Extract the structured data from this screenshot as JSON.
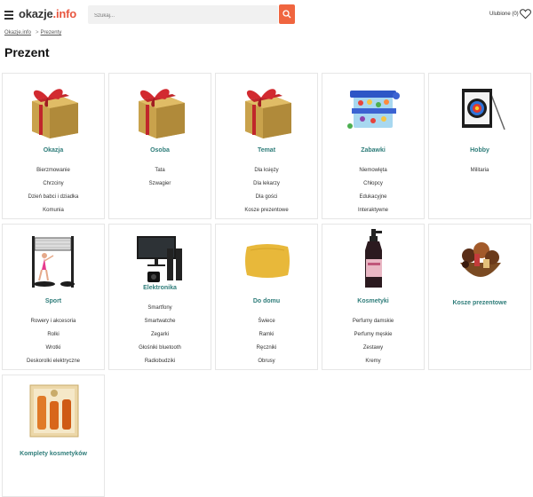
{
  "header": {
    "logo_main": "okazje",
    "logo_suffix": ".info",
    "search_placeholder": "Szukaj...",
    "favorites_label": "Ulubione (0)"
  },
  "breadcrumb": {
    "home": "Okazje.info",
    "separator": ">",
    "current": "Prezenty"
  },
  "page_title": "Prezent",
  "cards": [
    {
      "title": "Okazja",
      "icon": "gift-box",
      "items": [
        "Bierzmowanie",
        "Chrzciny",
        "Dzień babci i dziadka",
        "Komunia"
      ]
    },
    {
      "title": "Osoba",
      "icon": "gift-box",
      "items": [
        "Tata",
        "Szwagier"
      ]
    },
    {
      "title": "Temat",
      "icon": "gift-box",
      "items": [
        "Dla księży",
        "Dla lekarzy",
        "Dla gości",
        "Kosze prezentowe"
      ]
    },
    {
      "title": "Zabawki",
      "icon": "toy-bin",
      "items": [
        "Niemowlęta",
        "Chłopcy",
        "Edukacyjne",
        "Interaktywne"
      ]
    },
    {
      "title": "Hobby",
      "icon": "archery-target",
      "items": [
        "Militaria"
      ]
    },
    {
      "title": "Sport",
      "icon": "badminton-set",
      "items": [
        "Rowery i akcesoria",
        "Rolki",
        "Wrotki",
        "Deskorolki elektryczne"
      ]
    },
    {
      "title": "Elektronika",
      "icon": "tv-speakers",
      "items": [
        "Smartfony",
        "Smartwatche",
        "Zegarki",
        "Głośniki bluetooth",
        "Radiobudziki"
      ]
    },
    {
      "title": "Do domu",
      "icon": "pillow",
      "items": [
        "Świece",
        "Ramki",
        "Ręczniki",
        "Obrusy"
      ]
    },
    {
      "title": "Kosmetyki",
      "icon": "cosmetic-bottle",
      "items": [
        "Perfumy damskie",
        "Perfumy męskie",
        "Zestawy",
        "Kremy"
      ]
    },
    {
      "title": "Kosze prezentowe",
      "icon": "gift-basket",
      "items": []
    },
    {
      "title": "Komplety kosmetyków",
      "icon": "cosmetic-set",
      "items": []
    }
  ],
  "colors": {
    "accent": "#f0653f",
    "category": "#2f7d7a",
    "logo_suffix": "#e8563f"
  }
}
